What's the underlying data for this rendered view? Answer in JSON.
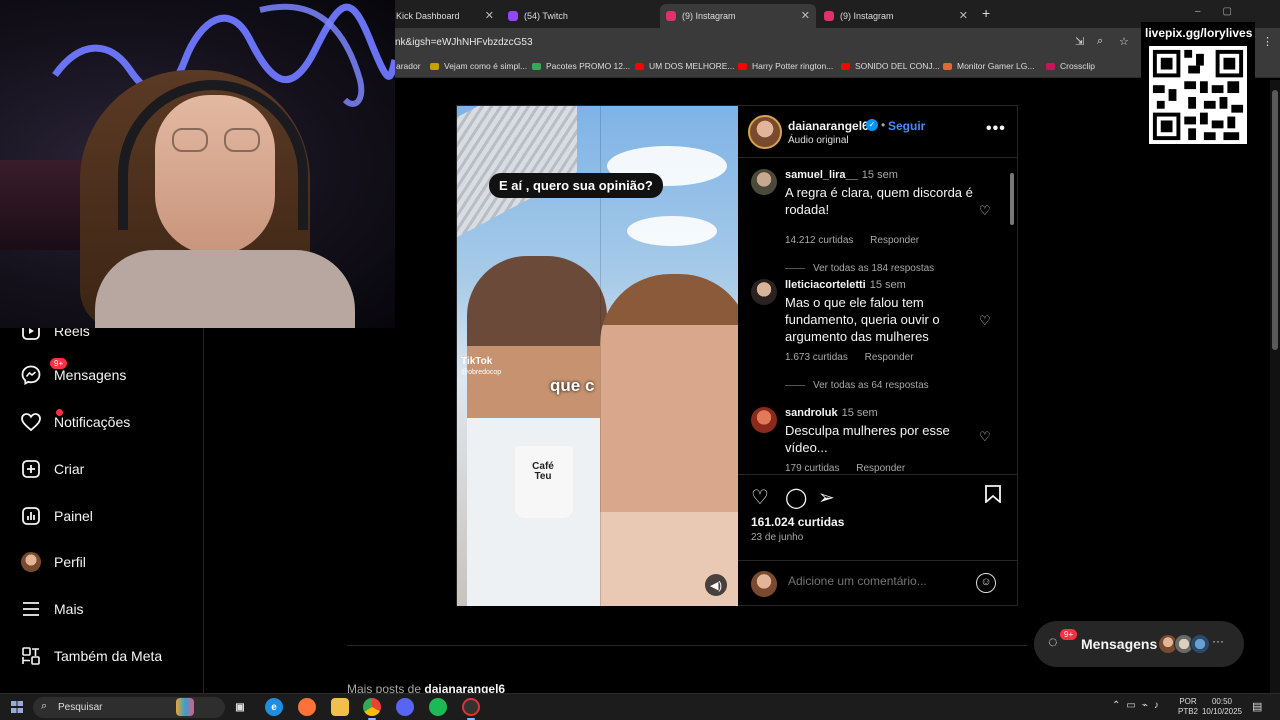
{
  "browser": {
    "tabs": [
      {
        "label": "Kick Dashboard",
        "favicon_color": "#53fc18"
      },
      {
        "label": "(54) Twitch",
        "favicon_color": "#9146ff"
      },
      {
        "label": "(9) Instagram",
        "favicon_color": "#e1306c"
      },
      {
        "label": "(9) Instagram",
        "favicon_color": "#e1306c"
      }
    ],
    "new_tab": "+",
    "url": "nk&igsh=eWJhNHFvbzdzcG53",
    "bookmarks": [
      {
        "label": "arador",
        "color": "#888888"
      },
      {
        "label": "Vejam como é simpl...",
        "color": "#c8a000"
      },
      {
        "label": "Pacotes PROMO 12...",
        "color": "#3aa757"
      },
      {
        "label": "UM DOS MELHORE...",
        "color": "#ff0000"
      },
      {
        "label": "Harry Potter rington...",
        "color": "#ff0000"
      },
      {
        "label": "SONIDO DEL CONJ...",
        "color": "#ff0000"
      },
      {
        "label": "Monitor Gamer LG...",
        "color": "#e0693a"
      },
      {
        "label": "Crossclip",
        "color": "#c2185b"
      }
    ]
  },
  "overlay": {
    "qr_label": "livepix.gg/lorylives"
  },
  "nav": {
    "items": [
      {
        "label": "Reels",
        "icon": "reels-icon"
      },
      {
        "label": "Mensagens",
        "icon": "messenger-icon",
        "badge": "9+"
      },
      {
        "label": "Notificações",
        "icon": "heart-icon"
      },
      {
        "label": "Criar",
        "icon": "plus-square-icon"
      },
      {
        "label": "Painel",
        "icon": "chart-icon"
      },
      {
        "label": "Perfil",
        "icon": "profile-avatar"
      },
      {
        "label": "Mais",
        "icon": "menu-icon"
      },
      {
        "label": "Também da Meta",
        "icon": "meta-icon"
      }
    ]
  },
  "post": {
    "username": "daianarangel6",
    "separator": "•",
    "follow": "Seguir",
    "audio": "Áudio original",
    "more": "•••",
    "video": {
      "caption": "E aí , quero sua opinião?",
      "tiktok": "TikTok",
      "tiktok_handle": "@obredocop",
      "subtitle": "que c",
      "mug_text": "Café Teu"
    },
    "comments": [
      {
        "user": "samuel_lira__",
        "time": "15 sem",
        "text": "A regra é clara, quem discorda é rodada!",
        "likes": "14.212 curtidas",
        "reply": "Responder",
        "replies": "Ver todas as 184 respostas"
      },
      {
        "user": "lleticiacorteletti",
        "time": "15 sem",
        "text": "Mas o que ele falou tem fundamento, queria ouvir o argumento das mulheres",
        "likes": "1.673 curtidas",
        "reply": "Responder",
        "replies": "Ver todas as 64 respostas"
      },
      {
        "user": "sandroluk",
        "time": "15 sem",
        "text": "Desculpa mulheres por esse vídeo...",
        "likes": "179 curtidas",
        "reply": "Responder",
        "replies": ""
      }
    ],
    "total_likes": "161.024 curtidas",
    "date": "23 de junho",
    "comment_placeholder": "Adicione um comentário..."
  },
  "more_posts": {
    "prefix": "Mais posts de",
    "user": "daianarangel6"
  },
  "messages_pill": {
    "label": "Mensagens",
    "badge": "9+"
  },
  "taskbar": {
    "search": "Pesquisar",
    "lang": "POR",
    "lang2": "PTB2",
    "time": "00:50",
    "date": "10/10/2025"
  },
  "colors": {
    "accent_blue": "#4a8cff",
    "badge_red": "#ff3040",
    "verified_blue": "#0095f6"
  }
}
